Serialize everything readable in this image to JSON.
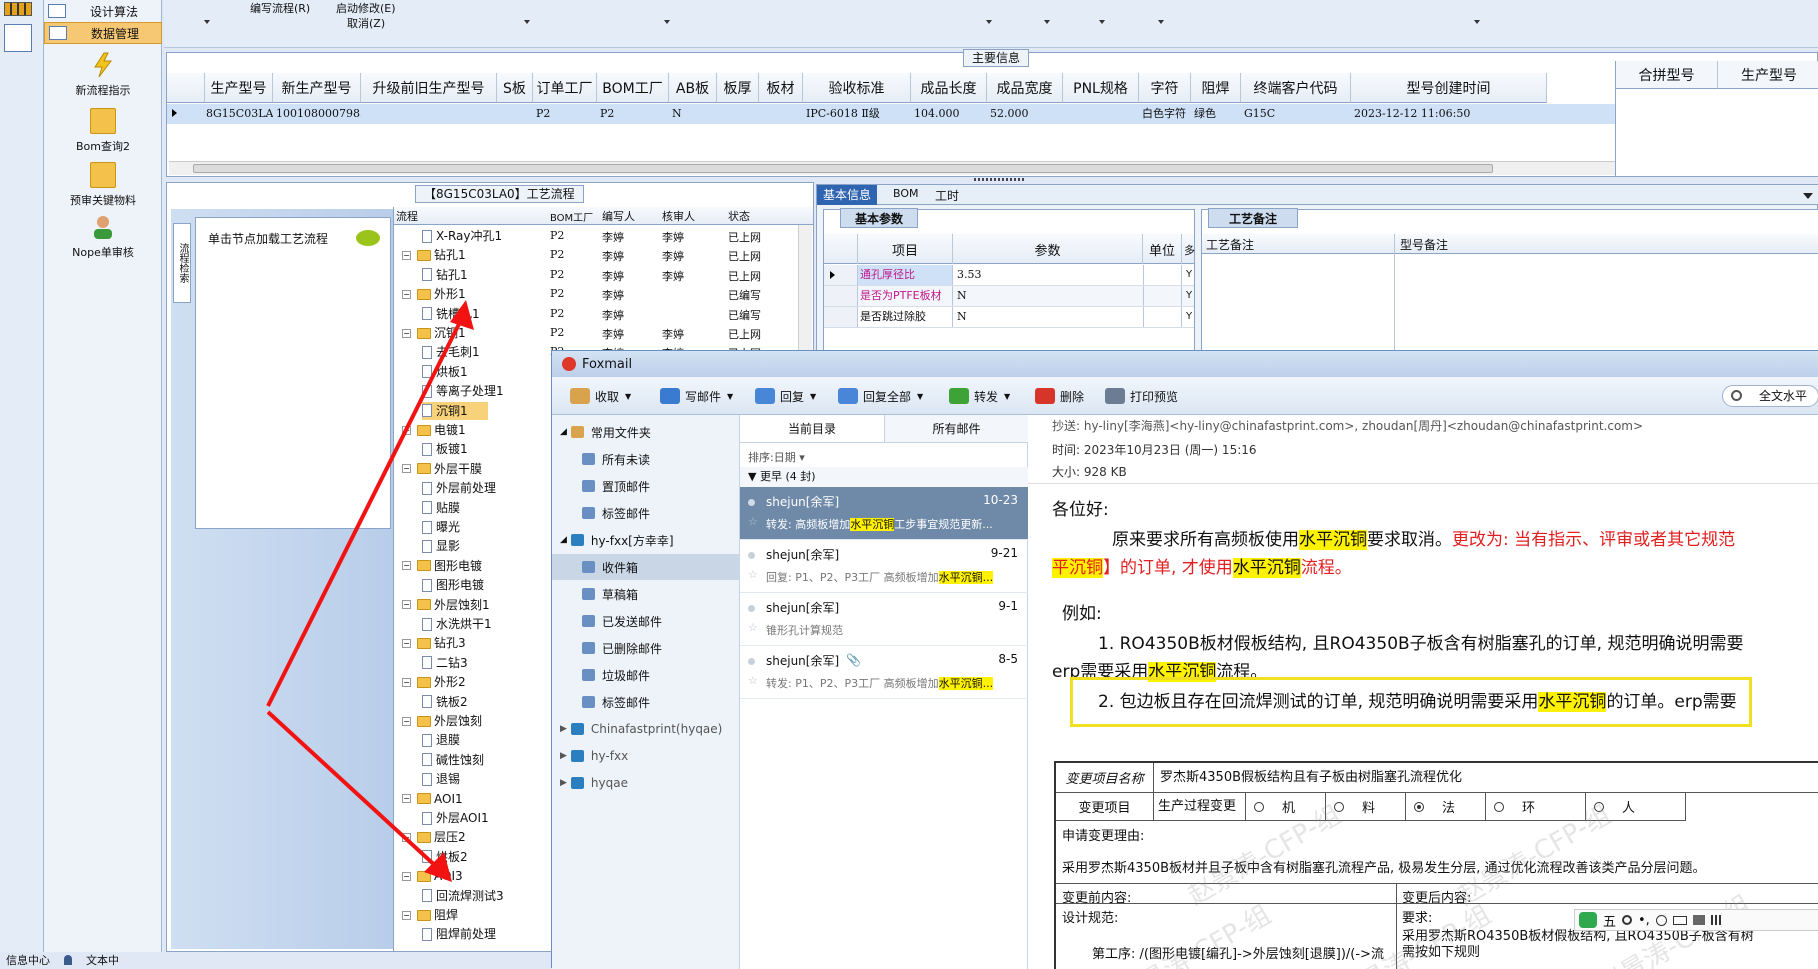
{
  "left_nav": {
    "top_items": [
      "设计算法",
      "数据管理"
    ],
    "big_items": [
      "新流程指示",
      "Bom查询2",
      "预审关键物料",
      "Nope单审核"
    ],
    "bottom_items": [
      "信息中心",
      "文本中"
    ]
  },
  "top_menu": {
    "items": [
      "编写流程(R)",
      "启动修改(E)",
      "取消(Z)"
    ]
  },
  "main_grid": {
    "title": "主要信息",
    "columns": [
      "生产型号",
      "新生产型号",
      "升级前旧生产型号",
      "S板",
      "订单工厂",
      "BOM工厂",
      "AB板",
      "板厚",
      "板材",
      "验收标准",
      "成品长度",
      "成品宽度",
      "PNL规格",
      "字符",
      "阻焊",
      "终端客户代码",
      "型号创建时间"
    ],
    "row": [
      "8G15C03LA0",
      "10010800079853",
      "",
      "",
      "P2",
      "P2",
      "N",
      "",
      "",
      "IPC-6018 Ⅱ级",
      "104.000",
      "52.000",
      "",
      "白色字符",
      "绿色",
      "G15C",
      "2023-12-12 11:06:50"
    ],
    "side_columns": [
      "合拼型号",
      "生产型号"
    ]
  },
  "process_panel": {
    "title": "【8G15C03LA0】工艺流程",
    "vertical_tab": "流程检索",
    "hint": "单击节点加载工艺流程",
    "columns": [
      "流程",
      "BOM工厂",
      "编写人",
      "核审人",
      "状态"
    ],
    "rows": [
      {
        "level": 2,
        "name": "X-Ray冲孔1",
        "bom": "P2",
        "writer": "李婷",
        "checker": "李婷",
        "status": "已上网"
      },
      {
        "level": 1,
        "name": "钻孔1",
        "bom": "P2",
        "writer": "李婷",
        "checker": "李婷",
        "status": "已上网"
      },
      {
        "level": 2,
        "name": "钻孔1",
        "bom": "P2",
        "writer": "李婷",
        "checker": "李婷",
        "status": "已上网"
      },
      {
        "level": 1,
        "name": "外形1",
        "bom": "P2",
        "writer": "李婷",
        "checker": "",
        "status": "已编写"
      },
      {
        "level": 2,
        "name": "铣槽孔1",
        "bom": "P2",
        "writer": "李婷",
        "checker": "",
        "status": "已编写"
      },
      {
        "level": 1,
        "name": "沉铜1",
        "bom": "P2",
        "writer": "李婷",
        "checker": "李婷",
        "status": "已上网"
      },
      {
        "level": 2,
        "name": "去毛刺1",
        "bom": "P2",
        "writer": "李婷",
        "checker": "李婷",
        "status": "已上网"
      },
      {
        "level": 2,
        "name": "烘板1",
        "bom": "",
        "writer": "",
        "checker": "",
        "status": ""
      },
      {
        "level": 2,
        "name": "等离子处理1",
        "bom": "",
        "writer": "",
        "checker": "",
        "status": ""
      },
      {
        "level": 2,
        "name": "沉铜1",
        "bom": "",
        "writer": "",
        "checker": "",
        "status": ""
      },
      {
        "level": 1,
        "name": "电镀1",
        "bom": "",
        "writer": "",
        "checker": "",
        "status": ""
      },
      {
        "level": 2,
        "name": "板镀1",
        "bom": "",
        "writer": "",
        "checker": "",
        "status": ""
      },
      {
        "level": 1,
        "name": "外层干膜",
        "bom": "",
        "writer": "",
        "checker": "",
        "status": ""
      },
      {
        "level": 2,
        "name": "外层前处理",
        "bom": "",
        "writer": "",
        "checker": "",
        "status": ""
      },
      {
        "level": 2,
        "name": "贴膜",
        "bom": "",
        "writer": "",
        "checker": "",
        "status": ""
      },
      {
        "level": 2,
        "name": "曝光",
        "bom": "",
        "writer": "",
        "checker": "",
        "status": ""
      },
      {
        "level": 2,
        "name": "显影",
        "bom": "",
        "writer": "",
        "checker": "",
        "status": ""
      },
      {
        "level": 1,
        "name": "图形电镀",
        "bom": "",
        "writer": "",
        "checker": "",
        "status": ""
      },
      {
        "level": 2,
        "name": "图形电镀",
        "bom": "",
        "writer": "",
        "checker": "",
        "status": ""
      },
      {
        "level": 1,
        "name": "外层蚀刻1",
        "bom": "",
        "writer": "",
        "checker": "",
        "status": ""
      },
      {
        "level": 2,
        "name": "水洗烘干1",
        "bom": "",
        "writer": "",
        "checker": "",
        "status": ""
      },
      {
        "level": 1,
        "name": "钻孔3",
        "bom": "",
        "writer": "",
        "checker": "",
        "status": ""
      },
      {
        "level": 2,
        "name": "二钻3",
        "bom": "",
        "writer": "",
        "checker": "",
        "status": ""
      },
      {
        "level": 1,
        "name": "外形2",
        "bom": "",
        "writer": "",
        "checker": "",
        "status": ""
      },
      {
        "level": 2,
        "name": "铣板2",
        "bom": "",
        "writer": "",
        "checker": "",
        "status": ""
      },
      {
        "level": 1,
        "name": "外层蚀刻",
        "bom": "",
        "writer": "",
        "checker": "",
        "status": ""
      },
      {
        "level": 2,
        "name": "退膜",
        "bom": "",
        "writer": "",
        "checker": "",
        "status": ""
      },
      {
        "level": 2,
        "name": "碱性蚀刻",
        "bom": "",
        "writer": "",
        "checker": "",
        "status": ""
      },
      {
        "level": 2,
        "name": "退锡",
        "bom": "",
        "writer": "",
        "checker": "",
        "status": ""
      },
      {
        "level": 1,
        "name": "AOI1",
        "bom": "",
        "writer": "",
        "checker": "",
        "status": ""
      },
      {
        "level": 2,
        "name": "外层AOI1",
        "bom": "",
        "writer": "",
        "checker": "",
        "status": ""
      },
      {
        "level": 1,
        "name": "层压2",
        "bom": "",
        "writer": "",
        "checker": "",
        "status": ""
      },
      {
        "level": 2,
        "name": "烘板2",
        "bom": "",
        "writer": "",
        "checker": "",
        "status": ""
      },
      {
        "level": 1,
        "name": "AOI3",
        "bom": "",
        "writer": "",
        "checker": "",
        "status": ""
      },
      {
        "level": 2,
        "name": "回流焊测试3",
        "bom": "",
        "writer": "",
        "checker": "",
        "status": ""
      },
      {
        "level": 1,
        "name": "阻焊",
        "bom": "",
        "writer": "",
        "checker": "",
        "status": ""
      },
      {
        "level": 2,
        "name": "阻焊前处理",
        "bom": "",
        "writer": "",
        "checker": "",
        "status": ""
      }
    ]
  },
  "info_panel": {
    "tabs": [
      "基本信息",
      "BOM",
      "工时"
    ],
    "basic_params_title": "基本参数",
    "param_columns": [
      "项目",
      "参数",
      "单位",
      "多"
    ],
    "params": [
      {
        "name": "通孔厚径比",
        "value": "3.53",
        "unit": "",
        "flag": "Y"
      },
      {
        "name": "是否为PTFE板材",
        "value": "N",
        "unit": "",
        "flag": "Y"
      },
      {
        "name": "是否跳过除胶",
        "value": "N",
        "unit": "",
        "flag": "Y"
      }
    ],
    "notes_title": "工艺备注",
    "notes_columns": [
      "工艺备注",
      "型号备注"
    ]
  },
  "foxmail": {
    "title": "Foxmail",
    "toolbar": [
      "收取",
      "写邮件",
      "回复",
      "回复全部",
      "转发",
      "删除",
      "打印预览"
    ],
    "search_placeholder": "全文水平",
    "folders": [
      {
        "label": "常用文件夹",
        "type": "group"
      },
      {
        "label": "所有未读",
        "type": "item"
      },
      {
        "label": "置顶邮件",
        "type": "item"
      },
      {
        "label": "标签邮件",
        "type": "item"
      },
      {
        "label": "hy-fxx[方幸幸]",
        "type": "account"
      },
      {
        "label": "收件箱",
        "type": "item",
        "selected": true
      },
      {
        "label": "草稿箱",
        "type": "item"
      },
      {
        "label": "已发送邮件",
        "type": "item"
      },
      {
        "label": "已删除邮件",
        "type": "item"
      },
      {
        "label": "垃圾邮件",
        "type": "item"
      },
      {
        "label": "标签邮件",
        "type": "item"
      },
      {
        "label": "Chinafastprint(hyqae)",
        "type": "account"
      },
      {
        "label": "hy-fxx",
        "type": "account"
      },
      {
        "label": "hyqae",
        "type": "account"
      }
    ],
    "list_tabs": [
      "当前目录",
      "所有邮件"
    ],
    "sort_label": "排序:日期",
    "group_label": "更早 (4 封)",
    "messages": [
      {
        "sender": "shejun[余军]",
        "date": "10-23",
        "pre": "转发: 高频板增加",
        "hl": "水平沉铜",
        "post": "工步事宜规范更新..."
      },
      {
        "sender": "shejun[余军]",
        "date": "9-21",
        "pre": "回复: P1、P2、P3工厂 高频板增加",
        "hl": "水平沉铜...",
        "post": ""
      },
      {
        "sender": "shejun[余军]",
        "date": "9-1",
        "pre": "锥形孔计算规范",
        "hl": "",
        "post": ""
      },
      {
        "sender": "shejun[余军]",
        "date": "8-5",
        "pre": "转发: P1、P2、P3工厂 高频板增加",
        "hl": "水平沉铜...",
        "post": ""
      }
    ],
    "header_cc": "抄送: hy-liny[李海燕]<hy-liny@chinafastprint.com>, zhoudan[周丹]<zhoudan@chinafastprint.com>",
    "header_time": "时间: 2023年10月23日 (周一) 15:16",
    "header_size": "大小: 928 KB",
    "greeting": "各位好:",
    "p1_a": "原来要求所有高频板使用",
    "p1_hl": "水平沉铜",
    "p1_b": "要求取消。",
    "p1_red": "更改为: 当有指示、评审或者其它规范",
    "p2_hl1": "平沉铜",
    "p2_a": "】的订单, 才使用",
    "p2_hl2": "水平沉铜",
    "p2_b": "流程。",
    "example": "例如:",
    "ex1_a": "1. RO4350B板材假板结构, 且RO4350B子板含有树脂塞孔的订单, 规范明确说明需要",
    "ex1_b": "erp需要采用",
    "ex1_hl": "水平沉铜",
    "ex1_c": "流程。",
    "ex2_a": "2. 包边板且存在回流焊测试的订单, 规范明确说明需要采用",
    "ex2_hl": "水平沉铜",
    "ex2_b": "的订单。erp需要",
    "table": {
      "item_name_label": "变更项目名称",
      "item_name": "罗杰斯4350B假板结构且有子板由树脂塞孔流程优化",
      "change_item_label": "变更项目",
      "change_type": "生产过程变更",
      "options": [
        "机",
        "料",
        "法",
        "环",
        "人"
      ],
      "selected_option": "法",
      "reason_label": "申请变更理由:",
      "reason": "采用罗杰斯4350B板材并且子板中含有树脂塞孔流程产品, 极易发生分层, 通过优化流程改善该类产品分层问题。",
      "before_label": "变更前内容:",
      "after_label": "变更后内容:",
      "design_label": "设计规范:",
      "req_label": "要求:",
      "req_text": "采用罗杰斯RO4350B板材假板结构, 且RO4350B子板含有树",
      "req_text2": "需按如下规则",
      "step_text": "第工序: /(图形电镀[编孔]->外层蚀刻[退膜])/(->流"
    },
    "watermark": "赵景涛-CFP-组"
  },
  "ime": {
    "label": "五"
  }
}
